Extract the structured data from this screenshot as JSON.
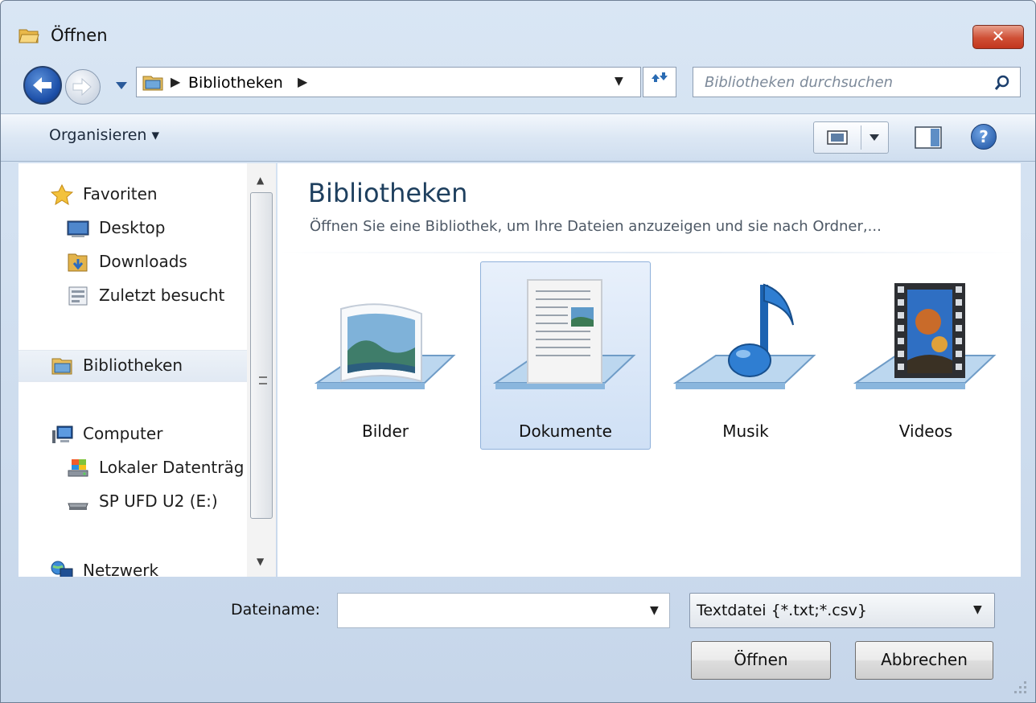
{
  "window": {
    "title": "Öffnen",
    "close_label": "✕"
  },
  "nav": {
    "path": [
      "Bibliotheken"
    ],
    "search_placeholder": "Bibliotheken durchsuchen"
  },
  "toolbar": {
    "organize_label": "Organisieren ▾",
    "help_label": "?"
  },
  "sidebar": {
    "favorites": {
      "label": "Favoriten",
      "items": [
        "Desktop",
        "Downloads",
        "Zuletzt besucht"
      ]
    },
    "libraries": {
      "label": "Bibliotheken"
    },
    "computer": {
      "label": "Computer",
      "items": [
        "Lokaler Datenträg",
        "SP UFD U2 (E:)"
      ]
    },
    "network": {
      "label": "Netzwerk"
    }
  },
  "content": {
    "title": "Bibliotheken",
    "subtitle": "Öffnen Sie eine Bibliothek, um Ihre Dateien anzuzeigen und sie nach Ordner,...",
    "libraries": [
      {
        "name": "Bilder",
        "icon": "pictures-library-icon"
      },
      {
        "name": "Dokumente",
        "icon": "documents-library-icon",
        "selected": true
      },
      {
        "name": "Musik",
        "icon": "music-library-icon"
      },
      {
        "name": "Videos",
        "icon": "videos-library-icon"
      }
    ]
  },
  "footer": {
    "filename_label": "Dateiname:",
    "filename_value": "",
    "filter_value": "Textdatei {*.txt;*.csv}",
    "open_label": "Öffnen",
    "cancel_label": "Abbrechen"
  }
}
